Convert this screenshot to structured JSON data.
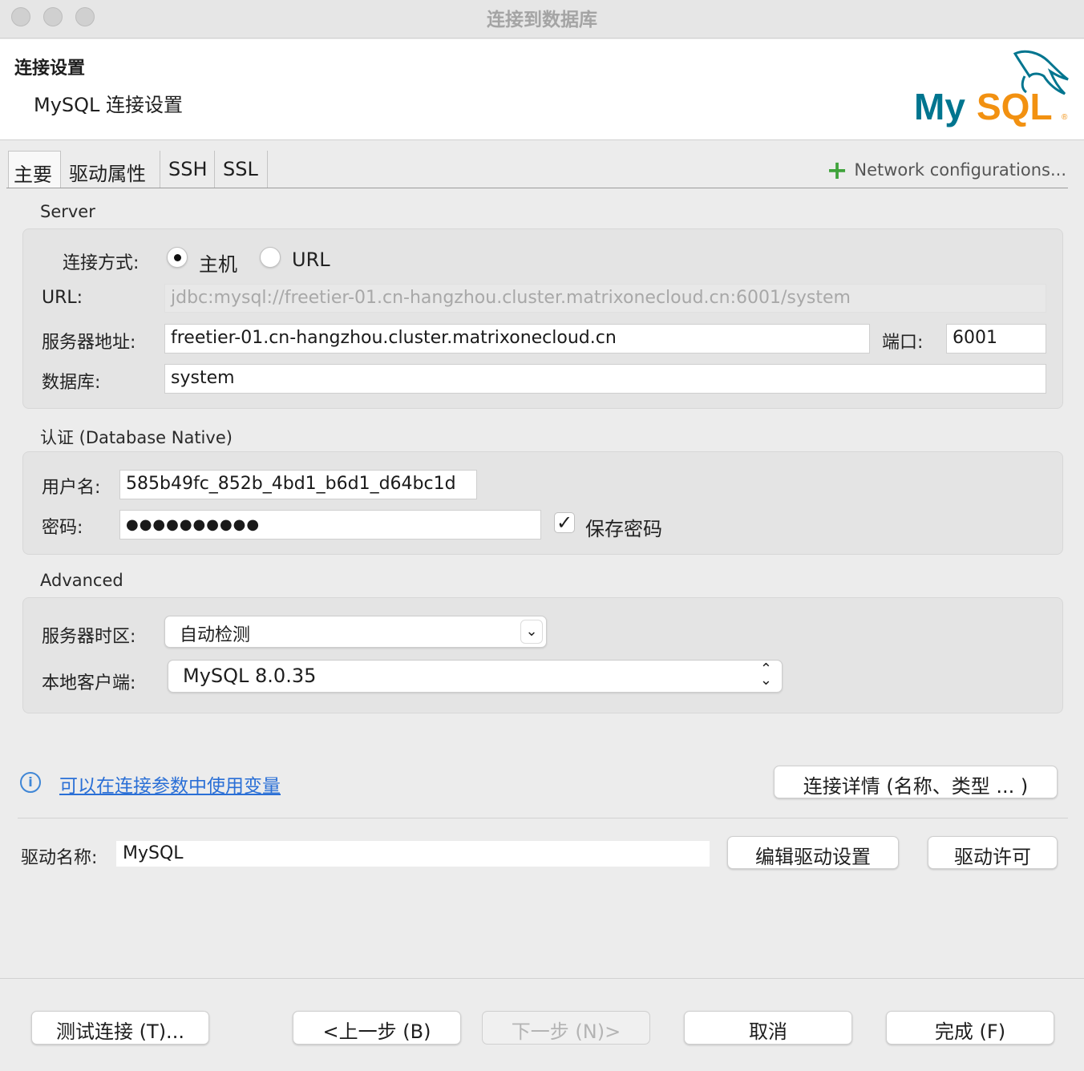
{
  "window": {
    "title": "连接到数据库"
  },
  "header": {
    "title": "连接设置",
    "subtitle": "MySQL 连接设置",
    "logo_text": "MySQL"
  },
  "tabs": [
    {
      "label": "主要"
    },
    {
      "label": "驱动属性"
    },
    {
      "label": "SSH"
    },
    {
      "label": "SSL"
    }
  ],
  "network_config": {
    "label": "Network configurations..."
  },
  "server": {
    "section_label": "Server",
    "connect_method_label": "连接方式:",
    "option_host": "主机",
    "option_url": "URL",
    "url_label": "URL:",
    "url_value": "jdbc:mysql://freetier-01.cn-hangzhou.cluster.matrixonecloud.cn:6001/system",
    "host_label": "服务器地址:",
    "host_value": "freetier-01.cn-hangzhou.cluster.matrixonecloud.cn",
    "port_label": "端口:",
    "port_value": "6001",
    "database_label": "数据库:",
    "database_value": "system"
  },
  "auth": {
    "section_label": "认证 (Database Native)",
    "username_label": "用户名:",
    "username_value": "585b49fc_852b_4bd1_b6d1_d64bc1d",
    "password_label": "密码:",
    "password_value": "●●●●●●●●●●",
    "save_password_label": "保存密码",
    "save_password_checked": "✓"
  },
  "advanced": {
    "section_label": "Advanced",
    "timezone_label": "服务器时区:",
    "timezone_value": "自动检测",
    "client_label": "本地客户端:",
    "client_value": "MySQL 8.0.35"
  },
  "footer_info": {
    "variables_link": "可以在连接参数中使用变量",
    "details_button": "连接详情 (名称、类型 ... )"
  },
  "driver": {
    "name_label": "驱动名称:",
    "name_value": "MySQL",
    "edit_button": "编辑驱动设置",
    "license_button": "驱动许可"
  },
  "buttons": {
    "test": "测试连接 (T)...",
    "back": "<上一步 (B)",
    "next": "下一步 (N)>",
    "cancel": "取消",
    "finish": "完成 (F)"
  },
  "colors": {
    "accent_green": "#3fa33b",
    "link_blue": "#2a6fd6",
    "mysql_teal": "#00758f",
    "mysql_orange": "#f29111"
  }
}
